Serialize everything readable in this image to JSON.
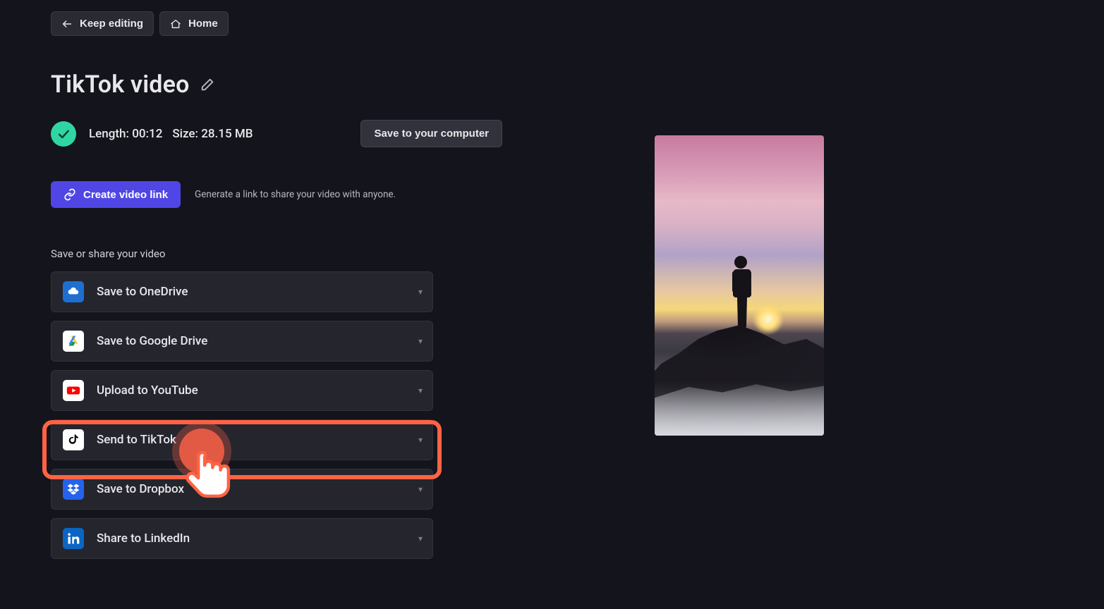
{
  "topbar": {
    "keep_editing": "Keep editing",
    "home": "Home"
  },
  "title": "TikTok video",
  "meta": {
    "length_label": "Length:",
    "length_value": "00:12",
    "size_label": "Size:",
    "size_value": "28.15 MB",
    "save_computer": "Save to your computer"
  },
  "link": {
    "create": "Create video link",
    "hint": "Generate a link to share your video with anyone."
  },
  "section_label": "Save or share your video",
  "options": [
    {
      "id": "onedrive",
      "label": "Save to OneDrive",
      "icon": "onedrive-icon"
    },
    {
      "id": "gdrive",
      "label": "Save to Google Drive",
      "icon": "google-drive-icon"
    },
    {
      "id": "youtube",
      "label": "Upload to YouTube",
      "icon": "youtube-icon"
    },
    {
      "id": "tiktok",
      "label": "Send to TikTok",
      "icon": "tiktok-icon",
      "highlighted": true
    },
    {
      "id": "dropbox",
      "label": "Save to Dropbox",
      "icon": "dropbox-icon"
    },
    {
      "id": "linkedin",
      "label": "Share to LinkedIn",
      "icon": "linkedin-icon"
    }
  ]
}
